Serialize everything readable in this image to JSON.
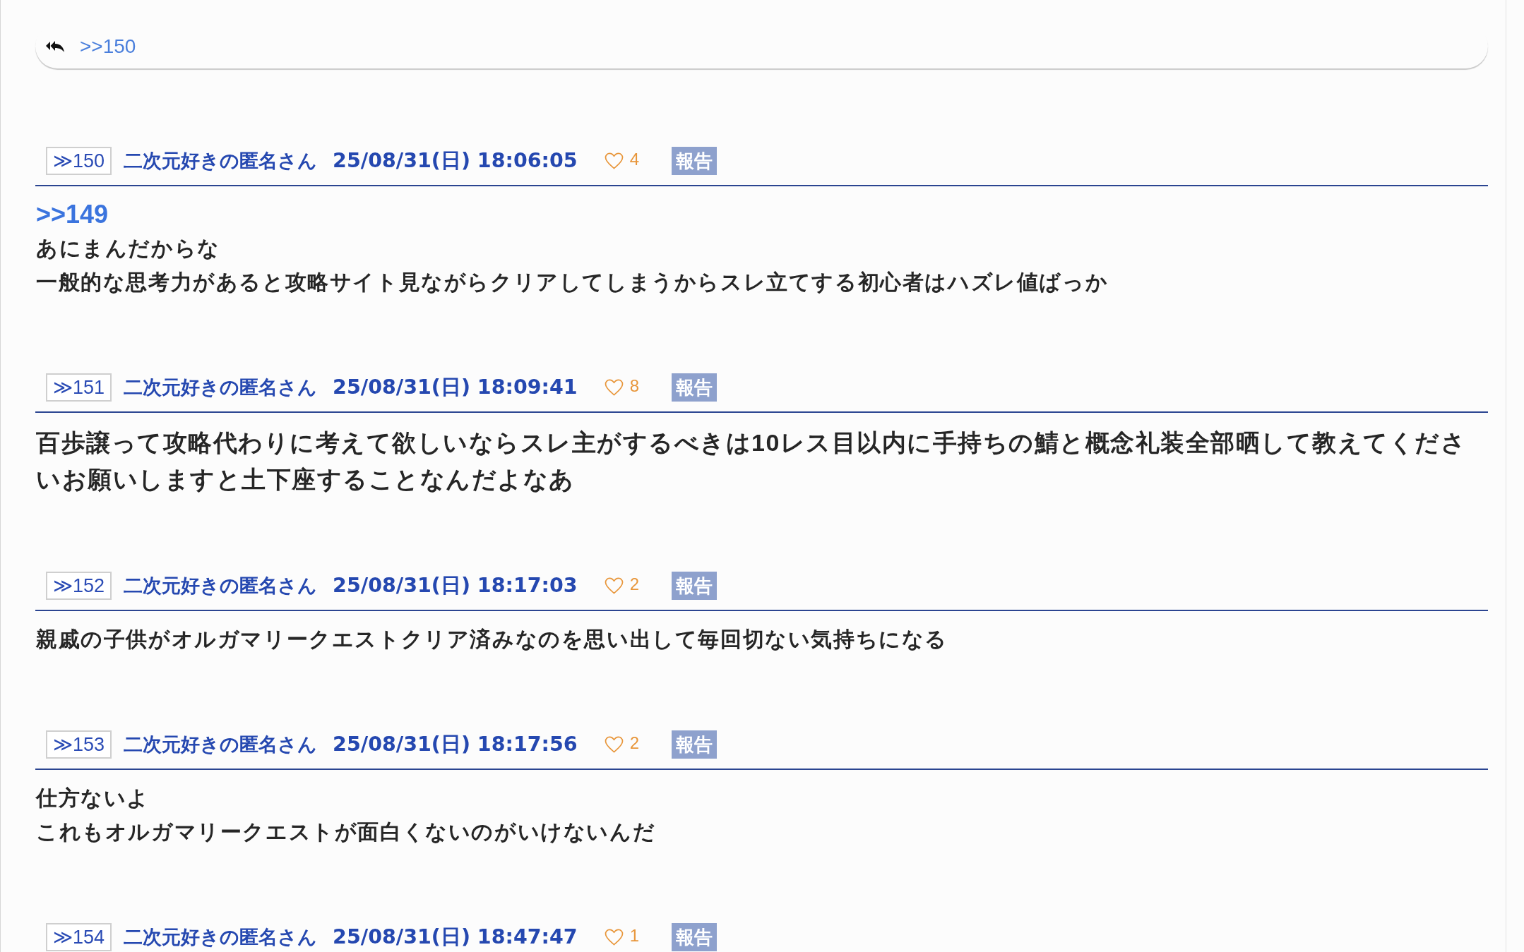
{
  "reply_bar": {
    "anchor": ">>150"
  },
  "posts": [
    {
      "number": "≫150",
      "name": "二次元好きの匿名さん",
      "date": "25/08/31(日) 18:06:05",
      "likes": "4",
      "report": "報告",
      "emphasized": false,
      "body": [
        {
          "kind": "anchor",
          "text": ">>149"
        },
        {
          "kind": "text",
          "text": "あにまんだからな"
        },
        {
          "kind": "text",
          "text": "一般的な思考力があると攻略サイト見ながらクリアしてしまうからスレ立てする初心者はハズレ値ばっか"
        }
      ]
    },
    {
      "number": "≫151",
      "name": "二次元好きの匿名さん",
      "date": "25/08/31(日) 18:09:41",
      "likes": "8",
      "report": "報告",
      "emphasized": true,
      "body": [
        {
          "kind": "text",
          "text": "百歩譲って攻略代わりに考えて欲しいならスレ主がするべきは10レス目以内に手持ちの鯖と概念礼装全部晒して教えてくださいお願いしますと土下座することなんだよなあ"
        }
      ]
    },
    {
      "number": "≫152",
      "name": "二次元好きの匿名さん",
      "date": "25/08/31(日) 18:17:03",
      "likes": "2",
      "report": "報告",
      "emphasized": false,
      "body": [
        {
          "kind": "text",
          "text": "親戚の子供がオルガマリークエストクリア済みなのを思い出して毎回切ない気持ちになる"
        }
      ]
    },
    {
      "number": "≫153",
      "name": "二次元好きの匿名さん",
      "date": "25/08/31(日) 18:17:56",
      "likes": "2",
      "report": "報告",
      "emphasized": false,
      "body": [
        {
          "kind": "text",
          "text": "仕方ないよ"
        },
        {
          "kind": "text",
          "text": "これもオルガマリークエストが面白くないのがいけないんだ"
        }
      ]
    },
    {
      "number": "≫154",
      "name": "二次元好きの匿名さん",
      "date": "25/08/31(日) 18:47:47",
      "likes": "1",
      "report": "報告"
    }
  ]
}
